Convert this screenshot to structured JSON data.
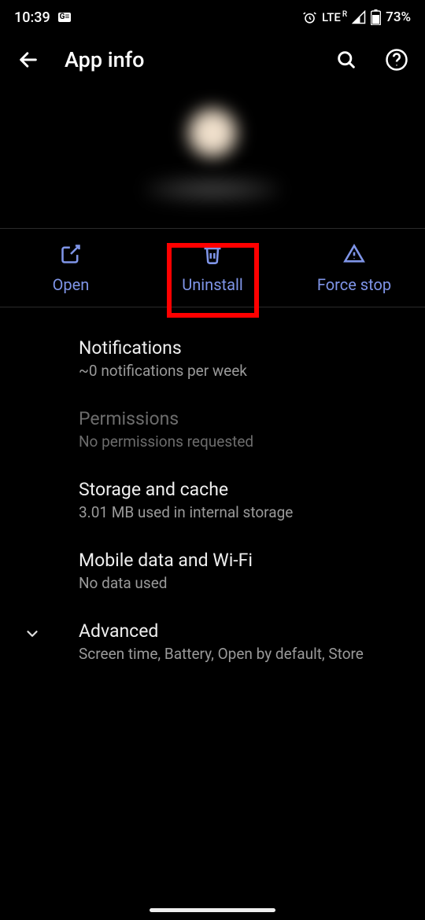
{
  "status": {
    "time": "10:39",
    "news_badge": "G≡",
    "network": "LTE",
    "roaming": "R",
    "battery": "73%"
  },
  "header": {
    "title": "App info"
  },
  "actions": {
    "open": "Open",
    "uninstall": "Uninstall",
    "force_stop": "Force stop"
  },
  "items": {
    "notifications": {
      "title": "Notifications",
      "sub": "~0 notifications per week"
    },
    "permissions": {
      "title": "Permissions",
      "sub": "No permissions requested"
    },
    "storage": {
      "title": "Storage and cache",
      "sub": "3.01 MB used in internal storage"
    },
    "data": {
      "title": "Mobile data and Wi-Fi",
      "sub": "No data used"
    },
    "advanced": {
      "title": "Advanced",
      "sub": "Screen time, Battery, Open by default, Store"
    }
  }
}
